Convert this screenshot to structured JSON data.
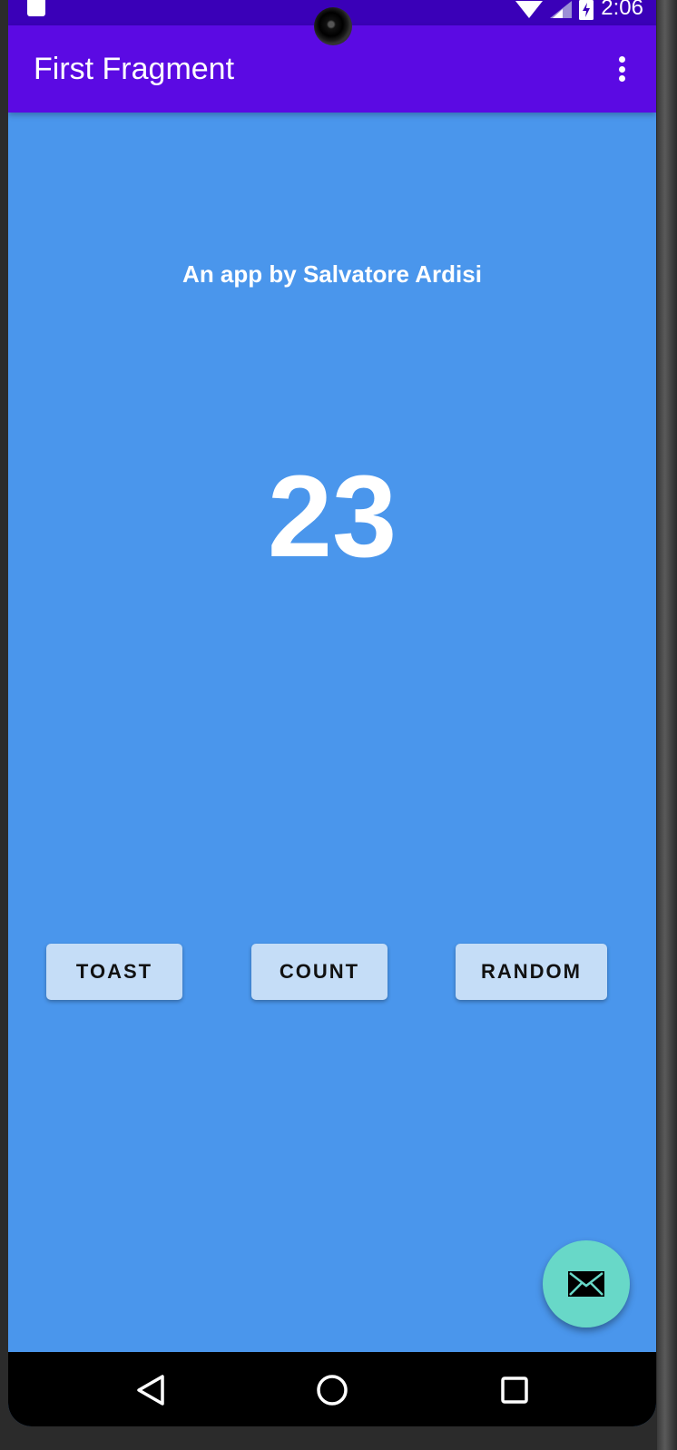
{
  "status_bar": {
    "time": "2:06",
    "background": "#3a00b8",
    "icons": [
      "sd-card-icon",
      "wifi-icon",
      "cell-signal-icon",
      "battery-charging-icon"
    ]
  },
  "app_bar": {
    "title": "First Fragment",
    "background": "#5b0ae3",
    "menu_icon": "overflow-menu-icon"
  },
  "content": {
    "background": "#4a96ec",
    "subtitle": "An app by Salvatore Ardisi",
    "counter": "23"
  },
  "buttons": {
    "toast": "TOAST",
    "count": "COUNT",
    "random": "RANDOM",
    "background": "#c5ddf7"
  },
  "fab": {
    "icon": "email-icon",
    "background": "#68d8c8"
  },
  "nav_bar": {
    "icons": [
      "back-icon",
      "home-icon",
      "recents-icon"
    ]
  }
}
